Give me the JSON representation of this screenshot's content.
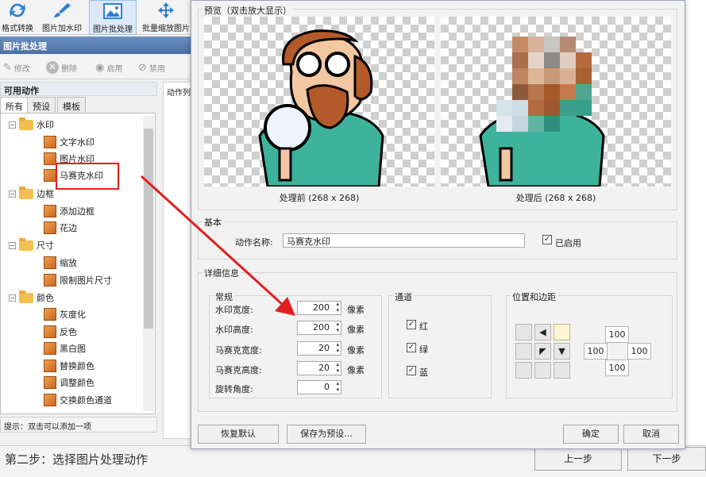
{
  "toolbar": {
    "items": [
      {
        "label": "格式转换",
        "icon": "convert-icon"
      },
      {
        "label": "图片加水印",
        "icon": "brush-icon"
      },
      {
        "label": "图片批处理",
        "icon": "image-icon"
      },
      {
        "label": "批量缩放图片",
        "icon": "move-arrows-icon"
      }
    ]
  },
  "panel": {
    "title": "图片批处理",
    "actions": {
      "edit": "修改",
      "delete": "删除",
      "enable": "启用",
      "disable": "禁用"
    },
    "available_title": "可用动作",
    "tabs": [
      "所有",
      "预设",
      "模板"
    ],
    "tree": {
      "watermark": "水印",
      "text_watermark": "文字水印",
      "image_watermark": "图片水印",
      "mosaic_watermark": "马赛克水印",
      "border": "边框",
      "add_border": "添加边框",
      "lace": "花边",
      "size": "尺寸",
      "scale": "缩放",
      "limit_size": "限制图片尺寸",
      "color": "颜色",
      "grayscale": "灰度化",
      "invert": "反色",
      "black_white": "黑白图",
      "replace_color": "替换颜色",
      "adjust_color": "调整颜色",
      "swap_channels": "交换颜色通道"
    },
    "hint": "提示：双击可以添加一项",
    "action_list_label": "动作列"
  },
  "status": {
    "step_text": "第二步：选择图片处理动作",
    "prev": "上一步",
    "next": "下一步"
  },
  "dialog": {
    "preview_title": "预览（双击放大显示）",
    "before_caption": "处理前 (268 x 268)",
    "after_caption": "处理后 (268 x 268)",
    "basic_title": "基本",
    "action_name_label": "动作名称:",
    "action_name_value": "马赛克水印",
    "enabled_label": "已启用",
    "detail_title": "详细信息",
    "general_title": "常规",
    "fields": [
      {
        "label": "水印宽度:",
        "value": "200",
        "unit": "像素"
      },
      {
        "label": "水印高度:",
        "value": "200",
        "unit": "像素"
      },
      {
        "label": "马赛克宽度:",
        "value": "20",
        "unit": "像素"
      },
      {
        "label": "马赛克高度:",
        "value": "20",
        "unit": "像素"
      },
      {
        "label": "旋转角度:",
        "value": "0",
        "unit": ""
      }
    ],
    "channel_title": "通道",
    "channels": [
      "红",
      "绿",
      "蓝"
    ],
    "position_title": "位置和边距",
    "margins": {
      "top": "100",
      "left": "100",
      "right": "100",
      "bottom": "100"
    },
    "buttons": {
      "restore": "恢复默认",
      "save_preset": "保存为预设...",
      "ok": "确定",
      "cancel": "取消"
    }
  },
  "colors": {
    "highlight": "#e02020",
    "accent": "#4a6fa3"
  }
}
